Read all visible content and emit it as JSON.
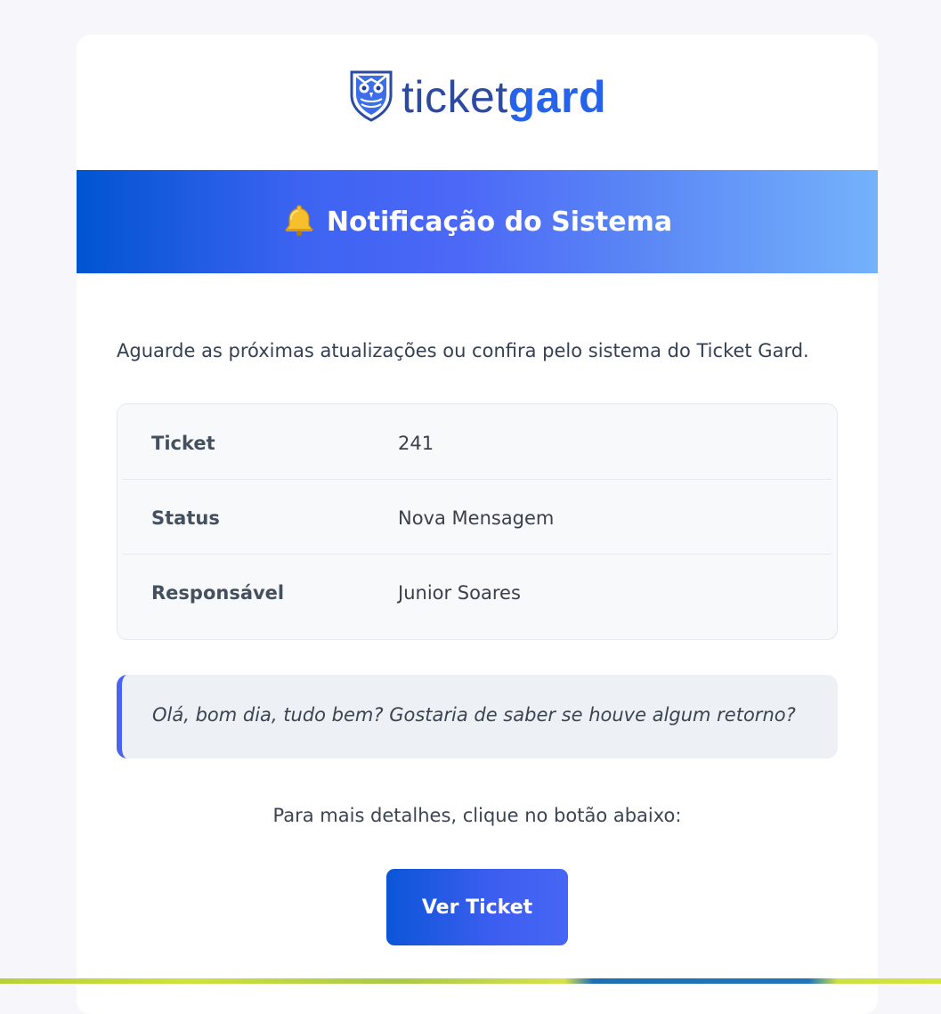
{
  "brand": {
    "name_light": "ticket",
    "name_bold": "gard",
    "logo_icon": "owl-shield-icon",
    "primary_color": "#2563eb",
    "secondary_color": "#2c4aa0"
  },
  "banner": {
    "icon": "bell-icon",
    "title": "Notificação do Sistema",
    "gradient": [
      "#0054d2",
      "#4c68f7",
      "#74b2fb"
    ]
  },
  "intro_text": "Aguarde as próximas atualizações ou confira pelo sistema do Ticket Gard.",
  "details": [
    {
      "label": "Ticket",
      "value": "241"
    },
    {
      "label": "Status",
      "value": "Nova Mensagem"
    },
    {
      "label": "Responsável",
      "value": "Junior Soares"
    }
  ],
  "message": "Olá, bom dia, tudo bem? Gostaria de saber se houve algum retorno?",
  "cta": {
    "text": "Para mais detalhes, clique no botão abaixo:",
    "button_label": "Ver Ticket",
    "button_color": "#3d5ef0"
  }
}
